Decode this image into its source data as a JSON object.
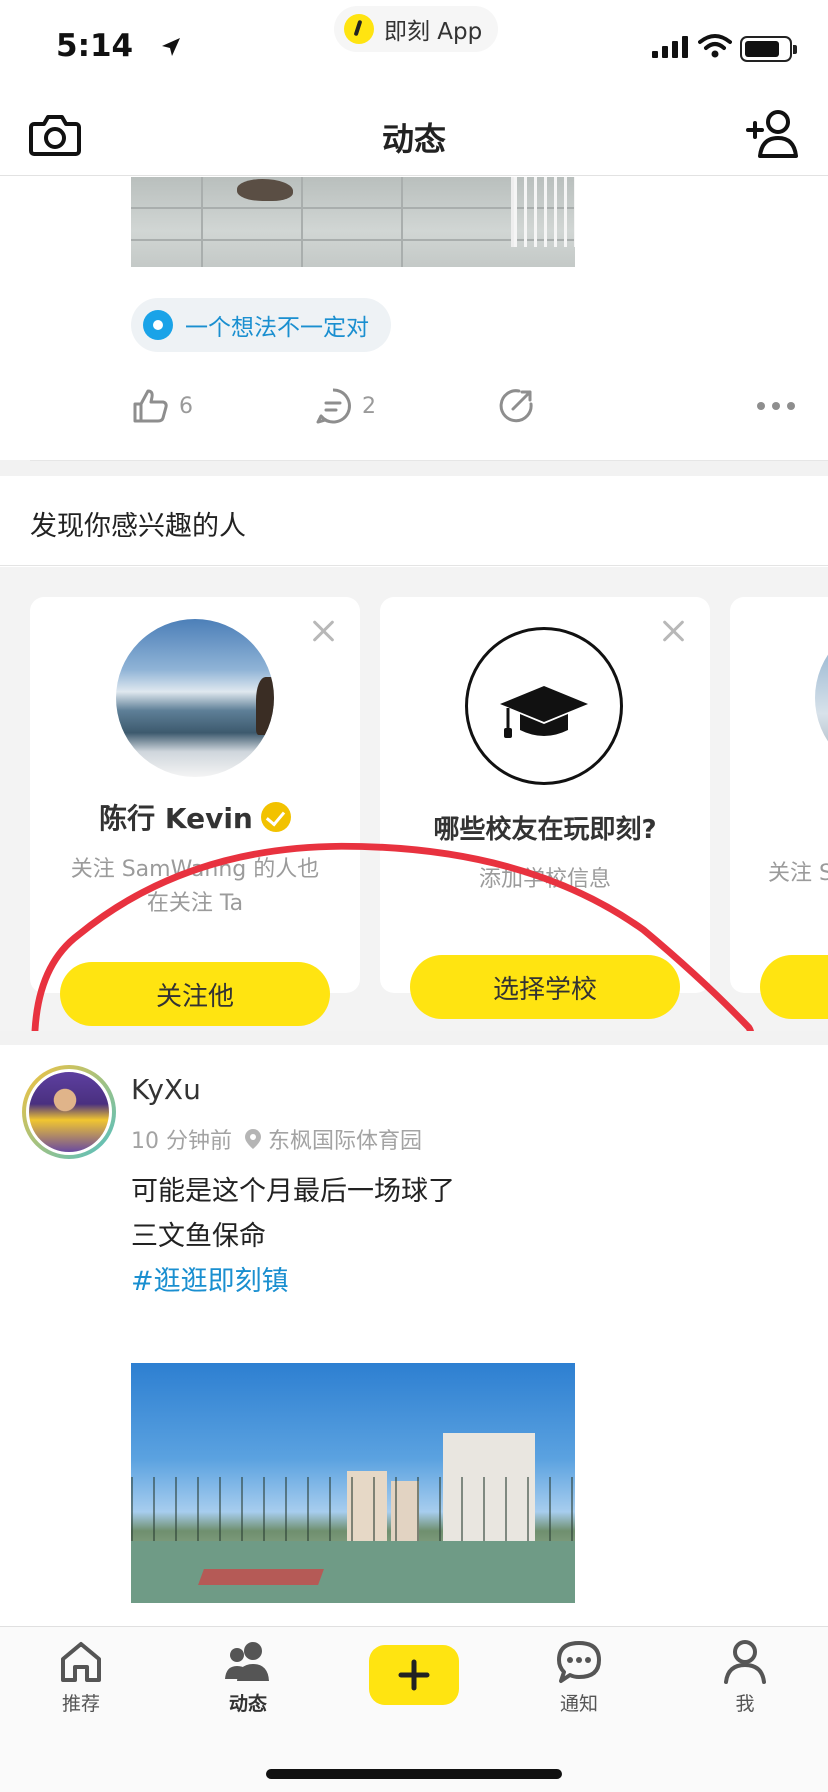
{
  "status_bar": {
    "time": "5:14",
    "app_pill": "即刻 App"
  },
  "nav": {
    "title": "动态"
  },
  "post_top": {
    "topic": "一个想法不一定对",
    "like_count": "6",
    "comment_count": "2"
  },
  "discover": {
    "title": "发现你感兴趣的人",
    "cards": [
      {
        "name": "陈行 Kevin",
        "subtitle_line1": "关注 SamWanng 的人也",
        "subtitle_line2": "在关注 Ta",
        "button": "关注他"
      },
      {
        "title": "哪些校友在玩即刻?",
        "subtitle": "添加学校信息",
        "button": "选择学校"
      },
      {
        "subtitle": "关注 S"
      }
    ]
  },
  "post2": {
    "author": "KyXu",
    "time": "10 分钟前",
    "location": "东枫国际体育园",
    "text_line1": "可能是这个月最后一场球了",
    "text_line2": "三文鱼保命",
    "tag": "#逛逛即刻镇"
  },
  "tabs": {
    "recommend": "推荐",
    "feed": "动态",
    "notify": "通知",
    "me": "我"
  },
  "colors": {
    "brand_yellow": "#ffe411",
    "link_blue": "#1a8fd0",
    "annotation_red": "#e8323f"
  }
}
